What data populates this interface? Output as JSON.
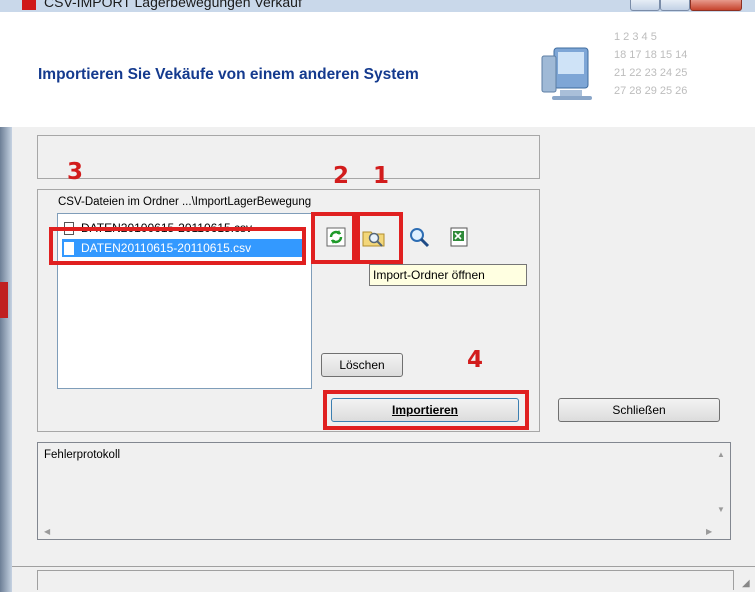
{
  "window": {
    "title": "CSV-IMPORT Lagerbewegungen Verkauf"
  },
  "header": {
    "title": "Importieren Sie Vekäufe von einem anderen System",
    "calendar_rows": [
      "1   2   3   4   5",
      "18  17  18  15  14",
      "21  22  23  24  25",
      "27  28  29  25  26"
    ]
  },
  "csv_group": {
    "label": "CSV-Dateien im Ordner ...\\ImportLagerBewegung",
    "files": [
      "DATEN20100615-20110615.csv",
      "DATEN20110615-20110615.csv"
    ],
    "selected_index": 1
  },
  "toolbar": {
    "refresh_icon": "refresh-icon",
    "open_folder_icon": "folder-search-icon",
    "search_icon": "magnifier-icon",
    "excel_icon": "excel-icon",
    "tooltip": "Import-Ordner öffnen"
  },
  "buttons": {
    "delete": "Löschen",
    "import": "Importieren",
    "close": "Schließen"
  },
  "log": {
    "label": "Fehlerprotokoll"
  },
  "annotations": {
    "n1": "1",
    "n2": "2",
    "n3": "3",
    "n4": "4",
    "color": "#e02020"
  },
  "colors": {
    "header_title": "#143a8e",
    "selection": "#3399ff"
  }
}
